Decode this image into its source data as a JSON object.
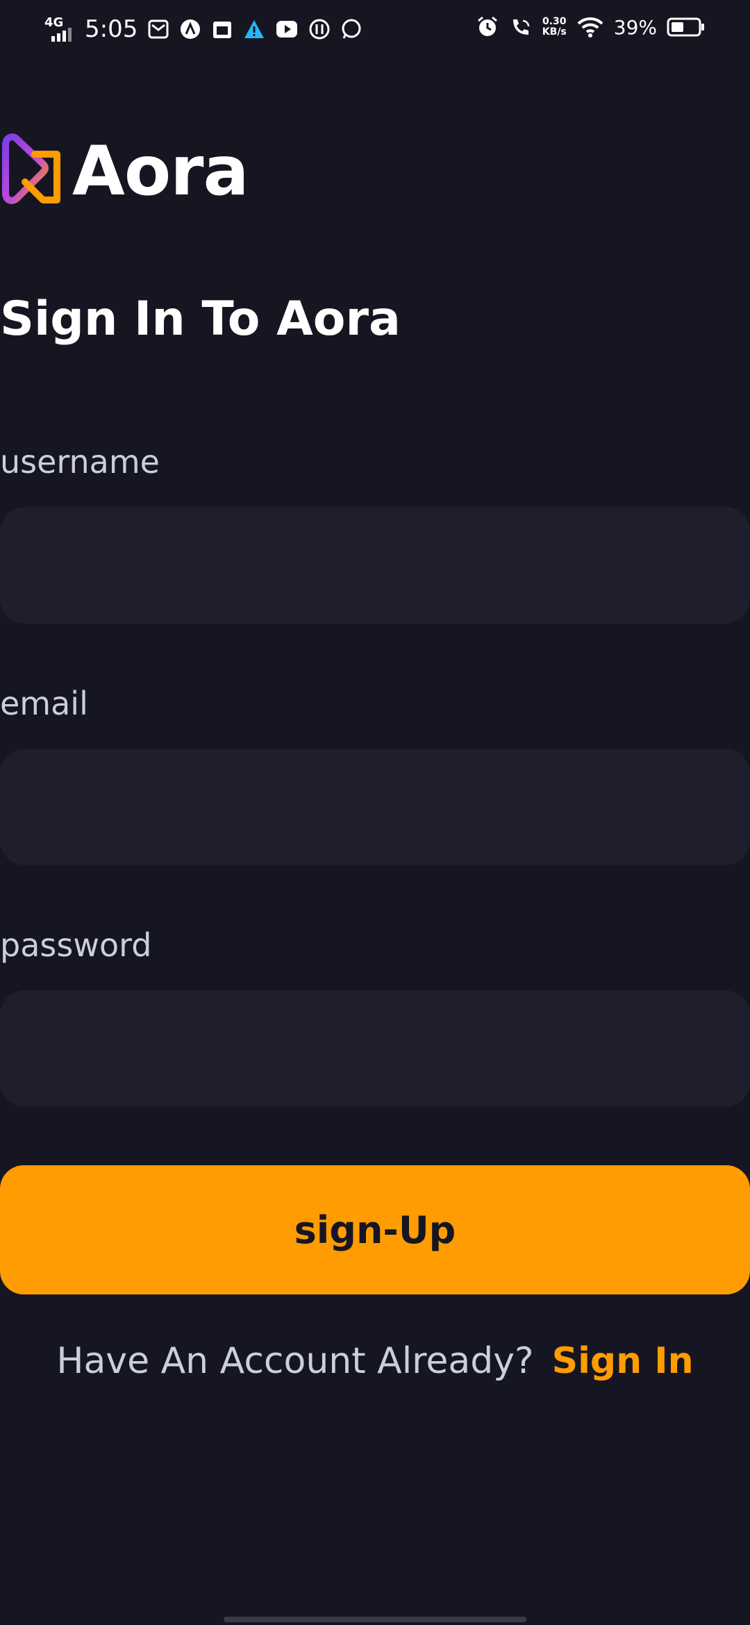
{
  "status_bar": {
    "network": "4G",
    "time": "5:05",
    "speed_top": "0.30",
    "speed_bottom": "KB/s",
    "battery": "39%"
  },
  "app": {
    "name": "Aora"
  },
  "form": {
    "title": "Sign In To Aora",
    "username_label": "username",
    "username_value": "",
    "email_label": "email",
    "email_value": "",
    "password_label": "password",
    "password_value": "",
    "submit_label": "sign-Up"
  },
  "footer": {
    "prompt": "Have An Account Already?",
    "link": "Sign In"
  },
  "colors": {
    "background": "#161622",
    "field": "#1E1E2D",
    "accent": "#FF9C01",
    "label": "#CDCDE0"
  }
}
